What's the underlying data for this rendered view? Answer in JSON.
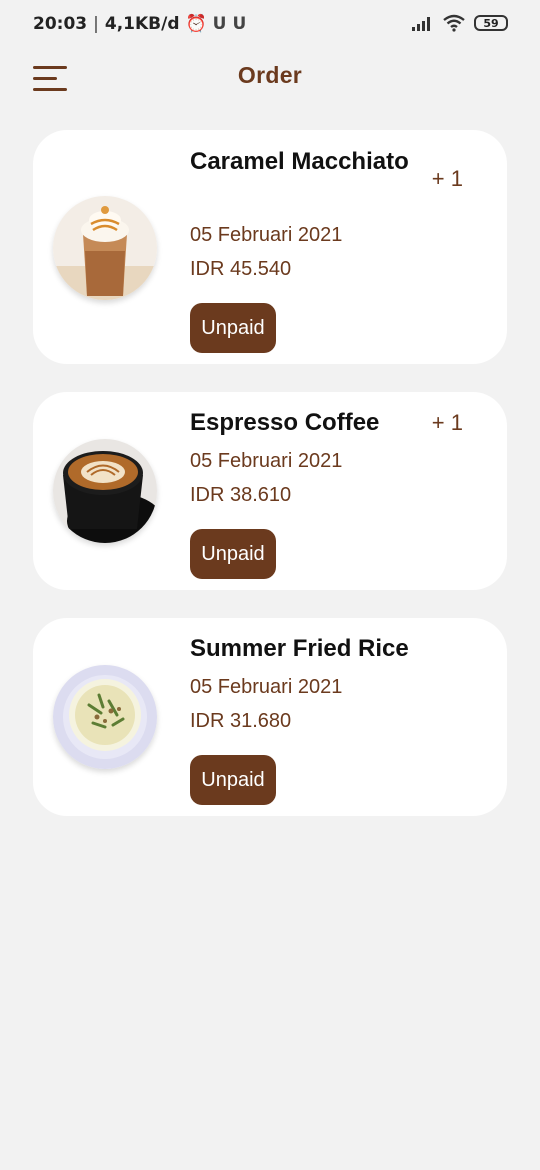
{
  "status_bar": {
    "time": "20:03",
    "separator": "|",
    "network_speed": "4,1KB/d",
    "alarm_icon": "alarm-clock-icon",
    "notification_icons": [
      "U",
      "U"
    ],
    "battery": "59"
  },
  "header": {
    "title": "Order",
    "menu_icon": "hamburger-menu-icon"
  },
  "orders": [
    {
      "name": "Caramel Macchiato",
      "quantity": "+ 1",
      "date": "05 Februari 2021",
      "price": "IDR 45.540",
      "status": "Unpaid",
      "image": "caramel-macchiato-photo"
    },
    {
      "name": "Espresso Coffee",
      "quantity": "+ 1",
      "date": "05 Februari 2021",
      "price": "IDR 38.610",
      "status": "Unpaid",
      "image": "espresso-coffee-photo"
    },
    {
      "name": "Summer Fried Rice",
      "date": "05 Februari 2021",
      "price": "IDR 31.680",
      "status": "Unpaid",
      "image": "summer-fried-rice-photo"
    }
  ],
  "colors": {
    "accent": "#6b3a1e",
    "background": "#f2f2f2",
    "card": "#ffffff"
  }
}
